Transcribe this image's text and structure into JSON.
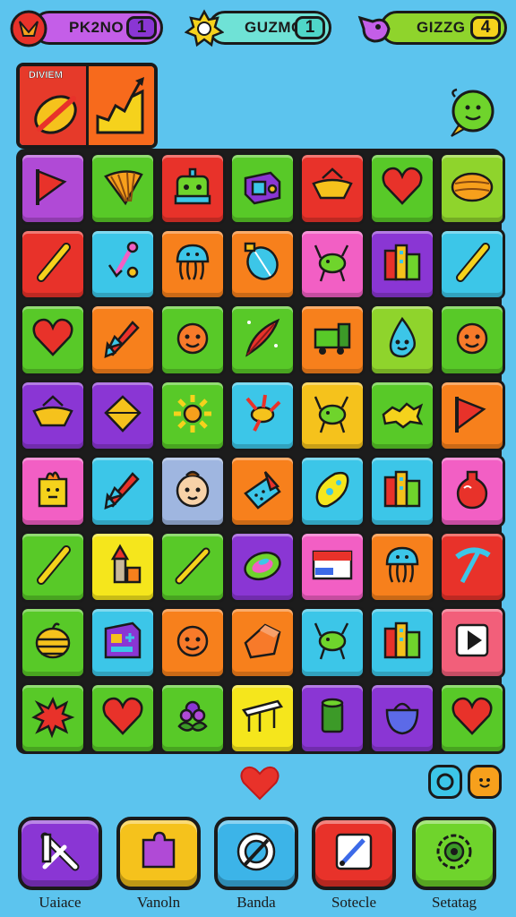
{
  "hud": {
    "left": {
      "text": "PK2NO",
      "count": "1",
      "color": "#a64ad6"
    },
    "center": {
      "text": "GUZMG",
      "count": "1",
      "color": "#4fd6c8"
    },
    "right": {
      "text": "GIZZG",
      "count": "4",
      "color": "#8fd42c"
    }
  },
  "mission": {
    "label": "DIVIEM"
  },
  "board": {
    "rows": [
      [
        {
          "color": "#b04ad6",
          "icon": "flag-icon"
        },
        {
          "color": "#58c928",
          "icon": "fan-leaf-icon"
        },
        {
          "color": "#e8322a",
          "icon": "robot-icon"
        },
        {
          "color": "#58c928",
          "icon": "box-icon"
        },
        {
          "color": "#e8322a",
          "icon": "bowl-icon"
        },
        {
          "color": "#58c928",
          "icon": "heart-icon"
        },
        {
          "color": "#8fd42c",
          "icon": "shell-icon"
        }
      ],
      [
        {
          "color": "#e8322a",
          "icon": "stick-icon"
        },
        {
          "color": "#3cc6e8",
          "icon": "tools-icon"
        },
        {
          "color": "#f7801c",
          "icon": "jellyfish-icon"
        },
        {
          "color": "#f7801c",
          "icon": "lantern-icon"
        },
        {
          "color": "#f25fc4",
          "icon": "creature-icon"
        },
        {
          "color": "#8a36d4",
          "icon": "buildings-icon"
        },
        {
          "color": "#3cc6e8",
          "icon": "stick-icon"
        }
      ],
      [
        {
          "color": "#58c928",
          "icon": "heart-icon"
        },
        {
          "color": "#f7801c",
          "icon": "rocket-icon"
        },
        {
          "color": "#58c928",
          "icon": "face-icon"
        },
        {
          "color": "#58c928",
          "icon": "feather-icon"
        },
        {
          "color": "#f7801c",
          "icon": "truck-icon"
        },
        {
          "color": "#8fd42c",
          "icon": "drop-face-icon"
        },
        {
          "color": "#58c928",
          "icon": "face-icon"
        }
      ],
      [
        {
          "color": "#8a36d4",
          "icon": "bowl-icon"
        },
        {
          "color": "#8a36d4",
          "icon": "diamond-icon"
        },
        {
          "color": "#58c928",
          "icon": "sun-icon"
        },
        {
          "color": "#3cc6e8",
          "icon": "bird-icon"
        },
        {
          "color": "#f5c21c",
          "icon": "creature-icon"
        },
        {
          "color": "#58c928",
          "icon": "spiky-icon"
        },
        {
          "color": "#f7801c",
          "icon": "flag-icon"
        }
      ],
      [
        {
          "color": "#f25fc4",
          "icon": "cube-face-icon"
        },
        {
          "color": "#3cc6e8",
          "icon": "rocket-icon"
        },
        {
          "color": "#9fb6e0",
          "icon": "baby-face-icon"
        },
        {
          "color": "#f7801c",
          "icon": "bag-icon"
        },
        {
          "color": "#3cc6e8",
          "icon": "sponge-icon"
        },
        {
          "color": "#3cc6e8",
          "icon": "buildings-icon"
        },
        {
          "color": "#f25fc4",
          "icon": "vase-icon"
        }
      ],
      [
        {
          "color": "#58c928",
          "icon": "stick-icon"
        },
        {
          "color": "#f5e61c",
          "icon": "tower-icon"
        },
        {
          "color": "#58c928",
          "icon": "brush-icon"
        },
        {
          "color": "#8a36d4",
          "icon": "gem-icon"
        },
        {
          "color": "#f25fc4",
          "icon": "picture-icon"
        },
        {
          "color": "#f7801c",
          "icon": "jellyfish-icon"
        },
        {
          "color": "#e8322a",
          "icon": "pickaxe-icon"
        }
      ],
      [
        {
          "color": "#58c928",
          "icon": "beehive-icon"
        },
        {
          "color": "#3cc6e8",
          "icon": "machine-icon"
        },
        {
          "color": "#f7801c",
          "icon": "face-icon"
        },
        {
          "color": "#f7801c",
          "icon": "block-icon"
        },
        {
          "color": "#3cc6e8",
          "icon": "creature-icon"
        },
        {
          "color": "#3cc6e8",
          "icon": "buildings-icon"
        },
        {
          "color": "#f25f7a",
          "icon": "play-icon"
        }
      ],
      [
        {
          "color": "#58c928",
          "icon": "splat-icon"
        },
        {
          "color": "#58c928",
          "icon": "heart-icon"
        },
        {
          "color": "#58c928",
          "icon": "flower-icon"
        },
        {
          "color": "#f5e61c",
          "icon": "bench-icon"
        },
        {
          "color": "#8a36d4",
          "icon": "can-icon"
        },
        {
          "color": "#8a36d4",
          "icon": "pouch-icon"
        },
        {
          "color": "#58c928",
          "icon": "heart-icon"
        }
      ]
    ]
  },
  "toolbar": {
    "buttons": [
      {
        "label": "Uaiace",
        "color": "#8a36d4",
        "icon": "cross-wand-icon"
      },
      {
        "label": "Vanoln",
        "color": "#f5c21c",
        "icon": "puzzle-icon"
      },
      {
        "label": "Banda",
        "color": "#3cb4e8",
        "icon": "target-icon"
      },
      {
        "label": "Sotecle",
        "color": "#e8322a",
        "icon": "pen-card-icon"
      },
      {
        "label": "Setatag",
        "color": "#6fd42c",
        "icon": "gear-icon"
      }
    ]
  }
}
